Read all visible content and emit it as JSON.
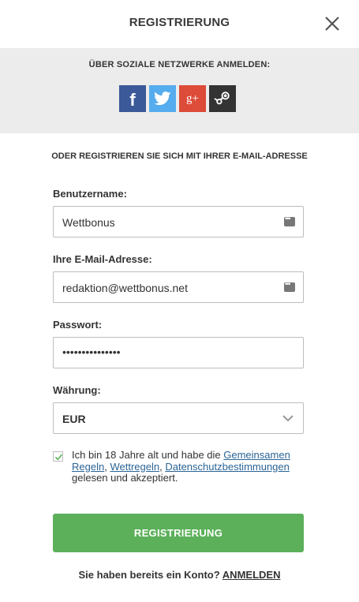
{
  "header": {
    "title": "REGISTRIERUNG",
    "close_icon": "close-icon"
  },
  "social": {
    "label": "ÜBER SOZIALE NETZWERKE ANMELDEN:",
    "buttons": [
      {
        "name": "facebook",
        "glyph": "f",
        "color": "#3b5998"
      },
      {
        "name": "twitter",
        "glyph": "twitter-bird",
        "color": "#55acee"
      },
      {
        "name": "google-plus",
        "glyph": "g+",
        "color": "#dd4b39"
      },
      {
        "name": "steam",
        "glyph": "steam-logo",
        "color": "#333333"
      }
    ]
  },
  "or_text": "ODER REGISTRIEREN SIE SICH MIT IHRER E-MAIL-ADRESSE",
  "form": {
    "username": {
      "label": "Benutzername:",
      "value": "Wettbonus"
    },
    "email": {
      "label": "Ihre E-Mail-Adresse:",
      "value": "redaktion@wettbonus.net"
    },
    "password": {
      "label": "Passwort:",
      "value": "•••••••••••••••"
    },
    "currency": {
      "label": "Währung:",
      "value": "EUR"
    },
    "terms": {
      "checked": true,
      "text_1": "Ich bin 18 Jahre alt und habe die",
      "link_1": "Gemeinsamen Regeln",
      "sep_1": ",",
      "link_2": "Wettregeln",
      "sep_2": ",",
      "link_3": "Datenschutzbestimmungen",
      "text_2": "gelesen und akzeptiert."
    },
    "submit_label": "REGISTRIERUNG"
  },
  "login": {
    "prompt": "Sie haben bereits ein Konto?",
    "link": "ANMELDEN"
  },
  "colors": {
    "accent_green": "#5cb05a",
    "link_blue": "#2a6496",
    "social_bg": "#ececec"
  }
}
